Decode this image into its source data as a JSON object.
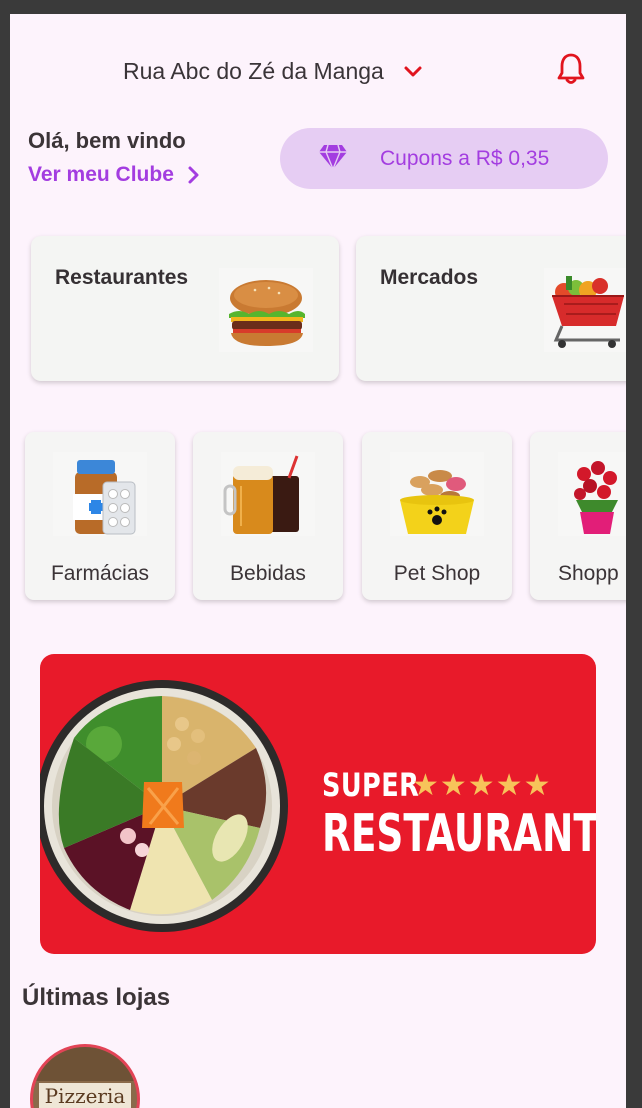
{
  "header": {
    "address": "Rua Abc do Zé da Manga"
  },
  "greeting": {
    "hello": "Olá, bem vindo",
    "club_link": "Ver meu Clube"
  },
  "coupon": {
    "label": "Cupons a R$ 0,35"
  },
  "main_categories": [
    {
      "label": "Restaurantes",
      "icon": "burger-icon"
    },
    {
      "label": "Mercados",
      "icon": "shopping-cart-icon"
    }
  ],
  "sub_categories": [
    {
      "label": "Farmácias",
      "icon": "medicine-icon"
    },
    {
      "label": "Bebidas",
      "icon": "drinks-icon"
    },
    {
      "label": "Pet Shop",
      "icon": "pet-food-icon"
    },
    {
      "label": "Shopp",
      "icon": "flowers-icon"
    }
  ],
  "banner": {
    "super": "SUPER",
    "stars": "★★★★★",
    "headline": "RESTAURANTES"
  },
  "recent": {
    "title": "Últimas lojas",
    "stores": [
      {
        "sign": "Pizzeria"
      }
    ]
  },
  "colors": {
    "accent": "#a33de0",
    "alert": "#e1141e",
    "banner": "#e81a2a",
    "background": "#fdf3fc"
  }
}
